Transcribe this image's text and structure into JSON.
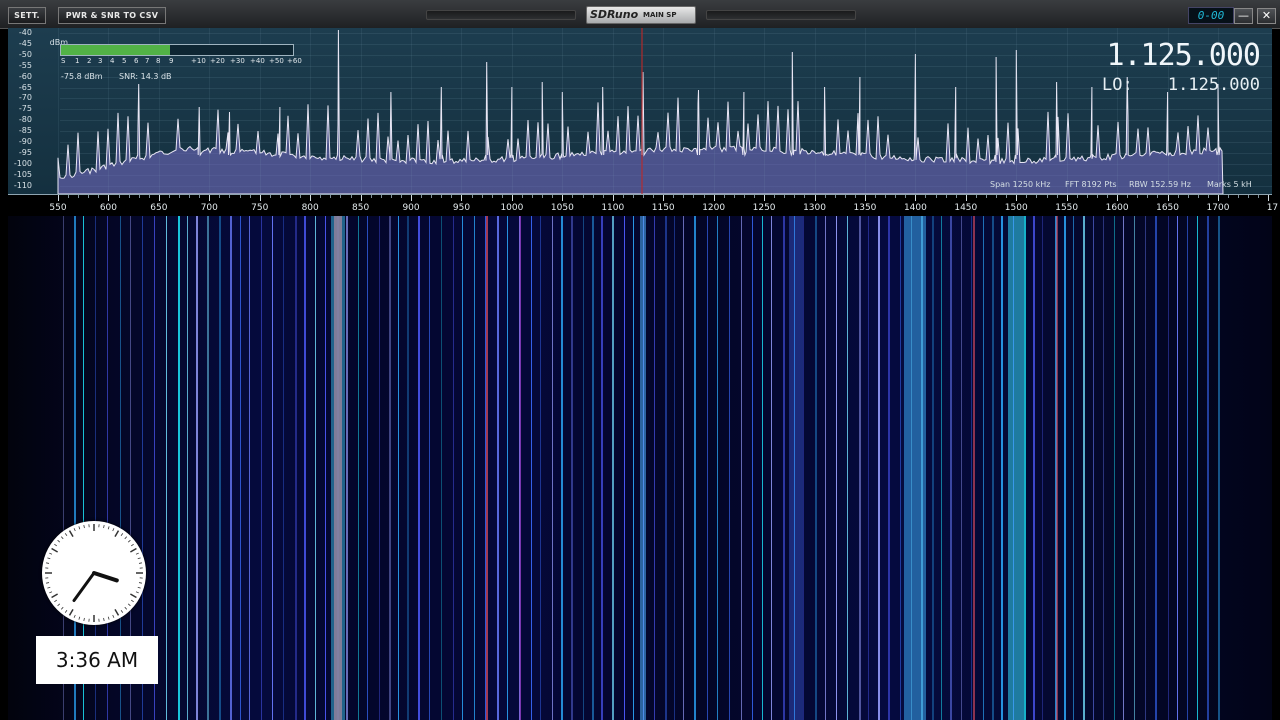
{
  "toolbar": {
    "settings_label": "SETT.",
    "pwr_snr_label": "PWR & SNR TO CSV"
  },
  "app_badge": {
    "logo": "SDRuno",
    "panel": "MAIN SP"
  },
  "window_controls": {
    "digital_clock": "0-00",
    "minimize": "—",
    "close": "✕"
  },
  "spectrum": {
    "dbm_unit": "dBm",
    "db_scale": [
      "-40",
      "-45",
      "-50",
      "-55",
      "-60",
      "-65",
      "-70",
      "-75",
      "-80",
      "-85",
      "-90",
      "-95",
      "-100",
      "-105",
      "-110"
    ],
    "smeter_scale": [
      "S",
      "1",
      "2",
      "3",
      "4",
      "5",
      "6",
      "7",
      "8",
      "9",
      "+10",
      "+20",
      "+30",
      "+40",
      "+50",
      "+60"
    ],
    "smeter_level_pct": 47,
    "power_text": "-75.8 dBm",
    "snr_text": "SNR: 14.3 dB",
    "vfo_frequency": "1.125.000",
    "lo_label": "LO:",
    "lo_frequency": "1.125.000",
    "span": "Span 1250 kHz",
    "fft": "FFT 8192 Pts",
    "rbw": "RBW 152.59 Hz",
    "marks": "Marks 5 kH"
  },
  "freq_axis": {
    "labels": [
      "550",
      "600",
      "650",
      "700",
      "750",
      "800",
      "850",
      "900",
      "950",
      "1000",
      "1050",
      "1100",
      "1150",
      "1200",
      "1250",
      "1300",
      "1350",
      "1400",
      "1450",
      "1500",
      "1550",
      "1600",
      "1650",
      "1700",
      "17"
    ]
  },
  "overlay": {
    "time": "3:36 AM"
  },
  "colors": {
    "smeter_fill": "#52b246",
    "spectrum_bg": "#1a384a",
    "waterfall_strong": "#d8404e"
  }
}
